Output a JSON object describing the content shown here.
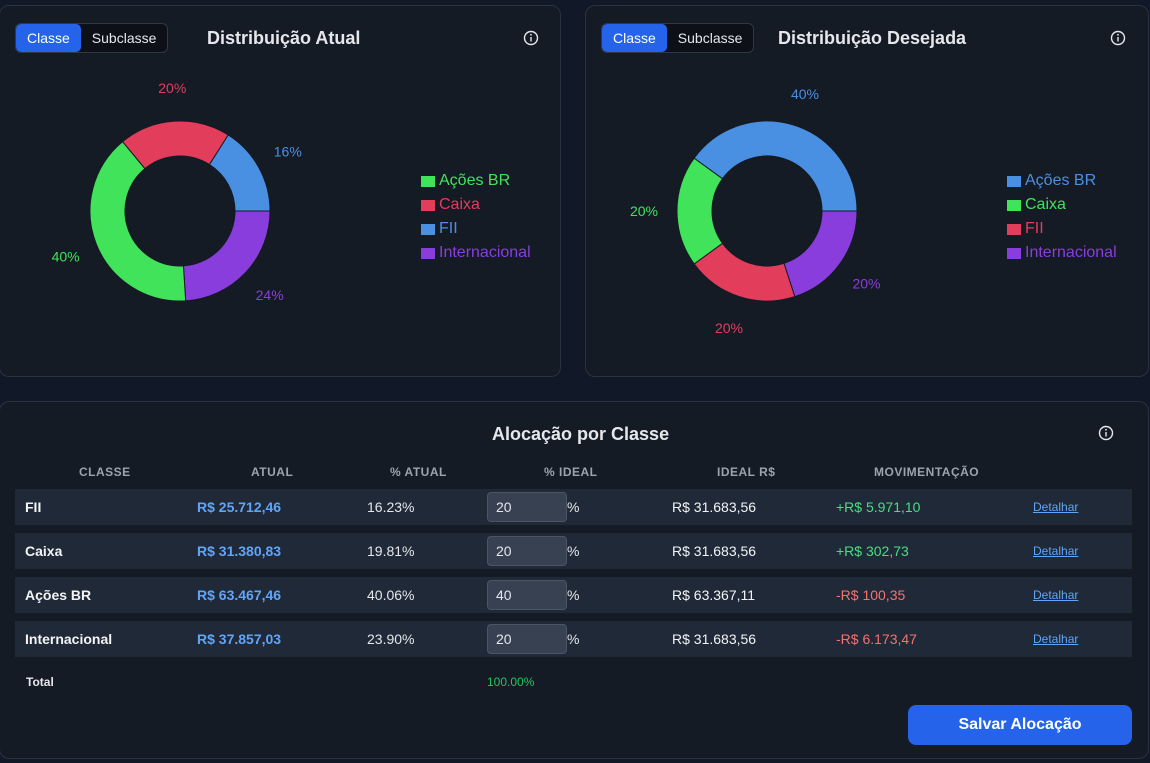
{
  "toggle": {
    "classe_label": "Classe",
    "subclasse_label": "Subclasse"
  },
  "charts": {
    "atual_title": "Distribuição Atual",
    "desejada_title": "Distribuição Desejada"
  },
  "chart_data": [
    {
      "type": "pie",
      "title": "Distribuição Atual",
      "categories": [
        "Ações BR",
        "Caixa",
        "FII",
        "Internacional"
      ],
      "values": [
        40,
        20,
        16,
        24
      ],
      "labels": [
        "40%",
        "20%",
        "16%",
        "24%"
      ],
      "colors": [
        "#41e35a",
        "#e23d5b",
        "#4a90e2",
        "#8a3ddd"
      ],
      "legend": "right"
    },
    {
      "type": "pie",
      "title": "Distribuição Desejada",
      "categories": [
        "Ações BR",
        "Caixa",
        "FII",
        "Internacional"
      ],
      "values": [
        40,
        20,
        20,
        20
      ],
      "labels": [
        "40%",
        "20%",
        "20%",
        "20%"
      ],
      "colors": [
        "#4a90e2",
        "#41e35a",
        "#e23d5b",
        "#8a3ddd"
      ],
      "legend": "right"
    }
  ],
  "allocation": {
    "title": "Alocação por Classe",
    "headers": [
      "CLASSE",
      "ATUAL",
      "% ATUAL",
      "% IDEAL",
      "IDEAL R$",
      "MOVIMENTAÇÃO"
    ],
    "rows": [
      {
        "classe": "FII",
        "atual": "R$ 25.712,46",
        "pct_atual": "16.23%",
        "pct_ideal": "20",
        "pct_sign": "%",
        "ideal": "R$ 31.683,56",
        "mov": "+R$ 5.971,10",
        "link": "Detalhar"
      },
      {
        "classe": "Caixa",
        "atual": "R$ 31.380,83",
        "pct_atual": "19.81%",
        "pct_ideal": "20",
        "pct_sign": "%",
        "ideal": "R$ 31.683,56",
        "mov": "+R$ 302,73",
        "link": "Detalhar"
      },
      {
        "classe": "Ações BR",
        "atual": "R$ 63.467,46",
        "pct_atual": "40.06%",
        "pct_ideal": "40",
        "pct_sign": "%",
        "ideal": "R$ 63.367,11",
        "mov": "-R$ 100,35",
        "link": "Detalhar"
      },
      {
        "classe": "Internacional",
        "atual": "R$ 37.857,03",
        "pct_atual": "23.90%",
        "pct_ideal": "20",
        "pct_sign": "%",
        "ideal": "R$ 31.683,56",
        "mov": "-R$ 6.173,47",
        "link": "Detalhar"
      }
    ],
    "total_label": "Total",
    "total_value": "100.00%",
    "save_label": "Salvar Alocação"
  },
  "colors": {
    "accent": "#2563eb",
    "positive": "#4ade80",
    "negative": "#f87171",
    "link": "#60a5fa"
  },
  "icons": {
    "info": "info-icon"
  }
}
